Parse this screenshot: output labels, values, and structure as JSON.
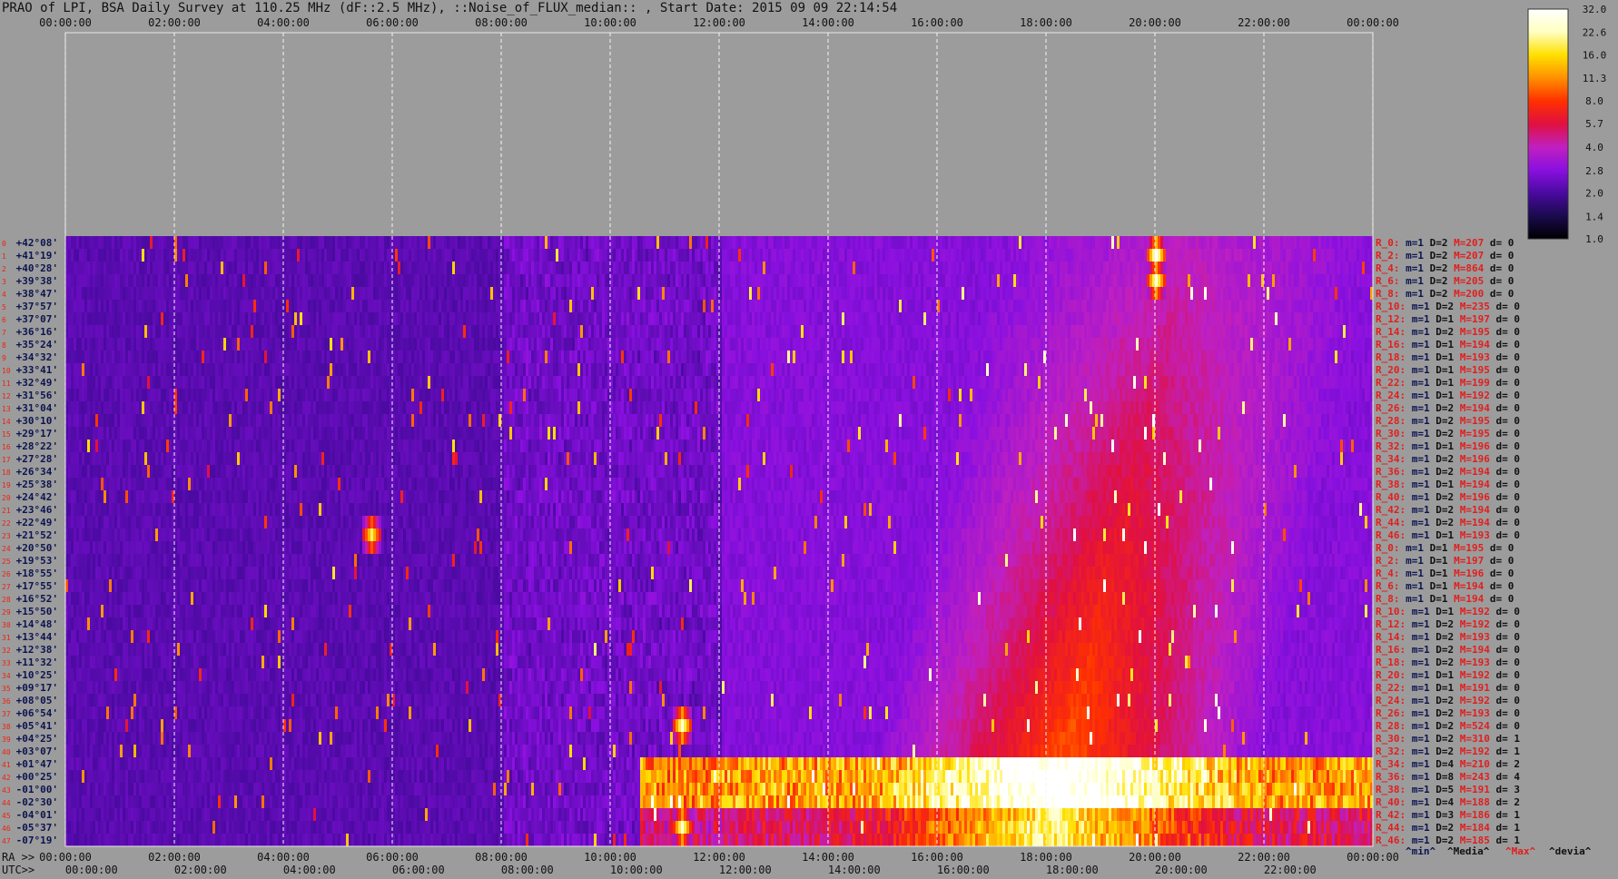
{
  "title": "PRAO of LPI, BSA Daily Survey at 110.25 MHz (dF::2.5 MHz), ::Noise_of_FLUX_median:: , Start Date: 2015 09 09 22:14:54",
  "colors": {
    "background": "#9c9c9c",
    "declination_label": "#0c1450",
    "row_index": "#e21e1e",
    "stat_min": "#0c1450",
    "stat_max": "#e21e1e"
  },
  "chart_data": {
    "type": "heatmap",
    "title": "PRAO of LPI, BSA Daily Survey at 110.25 MHz (dF::2.5 MHz), ::Noise_of_FLUX_median:: , Start Date: 2015 09 09 22:14:54",
    "top_axis_ticks": [
      "00:00:00",
      "02:00:00",
      "04:00:00",
      "06:00:00",
      "08:00:00",
      "10:00:00",
      "12:00:00",
      "14:00:00",
      "16:00:00",
      "18:00:00",
      "20:00:00",
      "22:00:00",
      "00:00:00"
    ],
    "ra_axis_label": "RA >>",
    "ra_axis_ticks": [
      "00:00:00",
      "02:00:00",
      "04:00:00",
      "06:00:00",
      "08:00:00",
      "10:00:00",
      "12:00:00",
      "14:00:00",
      "16:00:00",
      "18:00:00",
      "20:00:00",
      "22:00:00",
      "00:00:00"
    ],
    "utc_axis_label": "UTC>>",
    "utc_axis_ticks": [
      "00:00:00",
      "02:00:00",
      "04:00:00",
      "06:00:00",
      "08:00:00",
      "10:00:00",
      "12:00:00",
      "14:00:00",
      "16:00:00",
      "18:00:00",
      "20:00:00",
      "22:00:00"
    ],
    "declinations": [
      "+42°08'",
      "+41°19'",
      "+40°28'",
      "+39°38'",
      "+38°47'",
      "+37°57'",
      "+37°07'",
      "+36°16'",
      "+35°24'",
      "+34°32'",
      "+33°41'",
      "+32°49'",
      "+31°56'",
      "+31°04'",
      "+30°10'",
      "+29°17'",
      "+28°22'",
      "+27°28'",
      "+26°34'",
      "+25°38'",
      "+24°42'",
      "+23°46'",
      "+22°49'",
      "+21°52'",
      "+20°50'",
      "+19°53'",
      "+18°55'",
      "+17°55'",
      "+16°52'",
      "+15°50'",
      "+14°48'",
      "+13°44'",
      "+12°38'",
      "+11°32'",
      "+10°25'",
      "+09°17'",
      "+08°05'",
      "+06°54'",
      "+05°41'",
      "+04°25'",
      "+03°07'",
      "+01°47'",
      "+00°25'",
      "-01°00'",
      "-02°30'",
      "-04°01'",
      "-05°37'",
      "-07°19'"
    ],
    "row_stats": [
      {
        "r": "R_0:",
        "m": "m=1",
        "d": "D=2",
        "x": "M=207",
        "e": "d= 0"
      },
      {
        "r": "R_2:",
        "m": "m=1",
        "d": "D=2",
        "x": "M=207",
        "e": "d= 0"
      },
      {
        "r": "R_4:",
        "m": "m=1",
        "d": "D=2",
        "x": "M=864",
        "e": "d= 0"
      },
      {
        "r": "R_6:",
        "m": "m=1",
        "d": "D=2",
        "x": "M=205",
        "e": "d= 0"
      },
      {
        "r": "R_8:",
        "m": "m=1",
        "d": "D=2",
        "x": "M=200",
        "e": "d= 0"
      },
      {
        "r": "R_10:",
        "m": "m=1",
        "d": "D=2",
        "x": "M=235",
        "e": "d= 0"
      },
      {
        "r": "R_12:",
        "m": "m=1",
        "d": "D=1",
        "x": "M=197",
        "e": "d= 0"
      },
      {
        "r": "R_14:",
        "m": "m=1",
        "d": "D=2",
        "x": "M=195",
        "e": "d= 0"
      },
      {
        "r": "R_16:",
        "m": "m=1",
        "d": "D=1",
        "x": "M=194",
        "e": "d= 0"
      },
      {
        "r": "R_18:",
        "m": "m=1",
        "d": "D=1",
        "x": "M=193",
        "e": "d= 0"
      },
      {
        "r": "R_20:",
        "m": "m=1",
        "d": "D=1",
        "x": "M=195",
        "e": "d= 0"
      },
      {
        "r": "R_22:",
        "m": "m=1",
        "d": "D=1",
        "x": "M=199",
        "e": "d= 0"
      },
      {
        "r": "R_24:",
        "m": "m=1",
        "d": "D=1",
        "x": "M=192",
        "e": "d= 0"
      },
      {
        "r": "R_26:",
        "m": "m=1",
        "d": "D=2",
        "x": "M=194",
        "e": "d= 0"
      },
      {
        "r": "R_28:",
        "m": "m=1",
        "d": "D=2",
        "x": "M=195",
        "e": "d= 0"
      },
      {
        "r": "R_30:",
        "m": "m=1",
        "d": "D=2",
        "x": "M=195",
        "e": "d= 0"
      },
      {
        "r": "R_32:",
        "m": "m=1",
        "d": "D=1",
        "x": "M=196",
        "e": "d= 0"
      },
      {
        "r": "R_34:",
        "m": "m=1",
        "d": "D=2",
        "x": "M=196",
        "e": "d= 0"
      },
      {
        "r": "R_36:",
        "m": "m=1",
        "d": "D=2",
        "x": "M=194",
        "e": "d= 0"
      },
      {
        "r": "R_38:",
        "m": "m=1",
        "d": "D=1",
        "x": "M=194",
        "e": "d= 0"
      },
      {
        "r": "R_40:",
        "m": "m=1",
        "d": "D=2",
        "x": "M=196",
        "e": "d= 0"
      },
      {
        "r": "R_42:",
        "m": "m=1",
        "d": "D=2",
        "x": "M=194",
        "e": "d= 0"
      },
      {
        "r": "R_44:",
        "m": "m=1",
        "d": "D=2",
        "x": "M=194",
        "e": "d= 0"
      },
      {
        "r": "R_46:",
        "m": "m=1",
        "d": "D=1",
        "x": "M=193",
        "e": "d= 0"
      },
      {
        "r": "R_0:",
        "m": "m=1",
        "d": "D=1",
        "x": "M=195",
        "e": "d= 0"
      },
      {
        "r": "R_2:",
        "m": "m=1",
        "d": "D=1",
        "x": "M=197",
        "e": "d= 0"
      },
      {
        "r": "R_4:",
        "m": "m=1",
        "d": "D=1",
        "x": "M=196",
        "e": "d= 0"
      },
      {
        "r": "R_6:",
        "m": "m=1",
        "d": "D=1",
        "x": "M=194",
        "e": "d= 0"
      },
      {
        "r": "R_8:",
        "m": "m=1",
        "d": "D=1",
        "x": "M=194",
        "e": "d= 0"
      },
      {
        "r": "R_10:",
        "m": "m=1",
        "d": "D=1",
        "x": "M=192",
        "e": "d= 0"
      },
      {
        "r": "R_12:",
        "m": "m=1",
        "d": "D=2",
        "x": "M=192",
        "e": "d= 0"
      },
      {
        "r": "R_14:",
        "m": "m=1",
        "d": "D=2",
        "x": "M=193",
        "e": "d= 0"
      },
      {
        "r": "R_16:",
        "m": "m=1",
        "d": "D=2",
        "x": "M=194",
        "e": "d= 0"
      },
      {
        "r": "R_18:",
        "m": "m=1",
        "d": "D=2",
        "x": "M=193",
        "e": "d= 0"
      },
      {
        "r": "R_20:",
        "m": "m=1",
        "d": "D=1",
        "x": "M=192",
        "e": "d= 0"
      },
      {
        "r": "R_22:",
        "m": "m=1",
        "d": "D=1",
        "x": "M=191",
        "e": "d= 0"
      },
      {
        "r": "R_24:",
        "m": "m=1",
        "d": "D=2",
        "x": "M=192",
        "e": "d= 0"
      },
      {
        "r": "R_26:",
        "m": "m=1",
        "d": "D=2",
        "x": "M=193",
        "e": "d= 0"
      },
      {
        "r": "R_28:",
        "m": "m=1",
        "d": "D=2",
        "x": "M=524",
        "e": "d= 0"
      },
      {
        "r": "R_30:",
        "m": "m=1",
        "d": "D=2",
        "x": "M=310",
        "e": "d= 1"
      },
      {
        "r": "R_32:",
        "m": "m=1",
        "d": "D=2",
        "x": "M=192",
        "e": "d= 1"
      },
      {
        "r": "R_34:",
        "m": "m=1",
        "d": "D=4",
        "x": "M=210",
        "e": "d= 2"
      },
      {
        "r": "R_36:",
        "m": "m=1",
        "d": "D=8",
        "x": "M=243",
        "e": "d= 4"
      },
      {
        "r": "R_38:",
        "m": "m=1",
        "d": "D=5",
        "x": "M=191",
        "e": "d= 3"
      },
      {
        "r": "R_40:",
        "m": "m=1",
        "d": "D=4",
        "x": "M=188",
        "e": "d= 2"
      },
      {
        "r": "R_42:",
        "m": "m=1",
        "d": "D=3",
        "x": "M=186",
        "e": "d= 1"
      },
      {
        "r": "R_44:",
        "m": "m=1",
        "d": "D=2",
        "x": "M=184",
        "e": "d= 1"
      },
      {
        "r": "R_46:",
        "m": "m=1",
        "d": "D=2",
        "x": "M=185",
        "e": "d= 1"
      }
    ],
    "stats_legend": [
      "^min^",
      "^Media^",
      "^Max^",
      "^devia^"
    ],
    "colorbar": {
      "ticks": [
        "32.0",
        "22.6",
        "16.0",
        "11.3",
        "8.0",
        "5.7",
        "4.0",
        "2.8",
        "2.0",
        "1.4",
        "1.0"
      ],
      "min": 1.0,
      "max": 32.0,
      "scale": "log",
      "colormap": [
        "#000000",
        "#1a0a4e",
        "#4a0aa0",
        "#8a10e0",
        "#c020c0",
        "#e01040",
        "#ff3000",
        "#ff9000",
        "#ffe000",
        "#ffffc0",
        "#ffffff"
      ]
    }
  }
}
